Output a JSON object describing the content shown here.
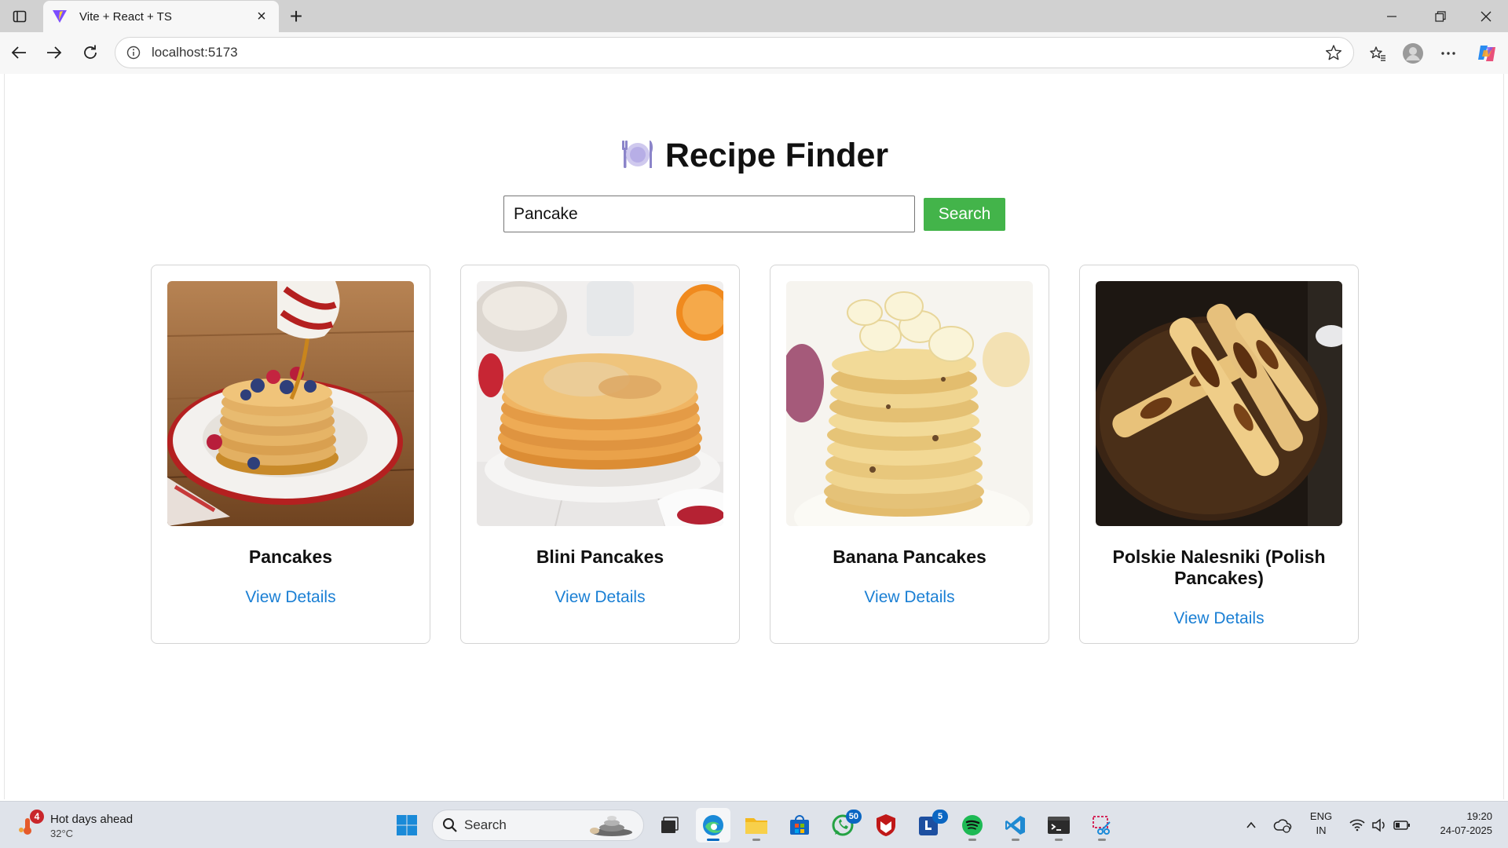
{
  "browser": {
    "tab_title": "Vite + React + TS",
    "tab_close": "×",
    "new_tab": "+",
    "url": "localhost:5173"
  },
  "app": {
    "emoji": "🍽️",
    "title": "Recipe Finder",
    "search": {
      "value": "Pancake",
      "button_label": "Search"
    },
    "link_label": "View Details",
    "recipes": [
      {
        "title": "Pancakes",
        "link": "View Details"
      },
      {
        "title": "Blini Pancakes",
        "link": "View Details"
      },
      {
        "title": "Banana Pancakes",
        "link": "View Details"
      },
      {
        "title": "Polskie Nalesniki (Polish Pancakes)",
        "link": "View Details"
      }
    ]
  },
  "taskbar": {
    "weather": {
      "badge": "4",
      "title": "Hot days ahead",
      "temp": "32°C"
    },
    "search_label": "Search",
    "badges": {
      "whatsapp": "50",
      "teams": "5"
    },
    "language": {
      "line1": "ENG",
      "line2": "IN"
    },
    "clock": {
      "time": "19:20",
      "date": "24-07-2025"
    }
  },
  "colors": {
    "search_button": "#43b44a",
    "link": "#1a7fd4",
    "accent": "#0067c0"
  }
}
